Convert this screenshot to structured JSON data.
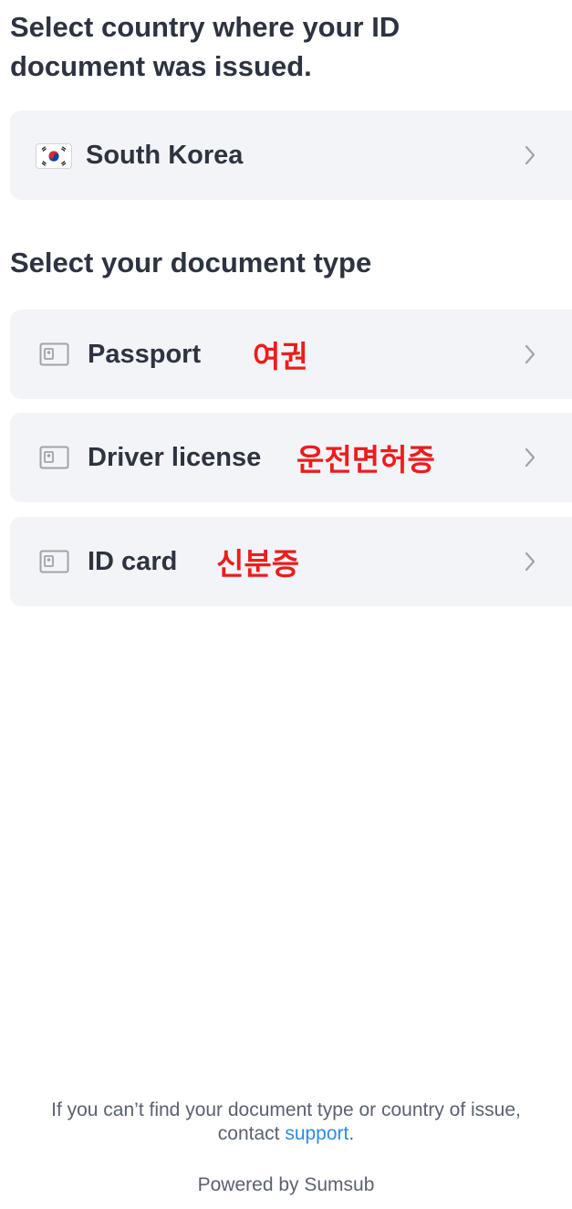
{
  "country_section": {
    "heading_line1": "Select country where your ID",
    "heading_line2": "document was issued.",
    "selected_country": "South Korea",
    "flag_icon": "south-korea-flag-icon"
  },
  "document_section": {
    "heading": "Select your document type",
    "options": [
      {
        "label": "Passport",
        "annotation": "여권",
        "icon": "id-card-icon"
      },
      {
        "label": "Driver license",
        "annotation": "운전면허증",
        "icon": "id-card-icon"
      },
      {
        "label": "ID card",
        "annotation": "신분증",
        "icon": "id-card-icon"
      }
    ]
  },
  "footer": {
    "note_line1": "If you can’t find your document type or country of issue,",
    "note_line2_prefix": "contact",
    "support_link": "support",
    "note_line2_suffix": ".",
    "powered_by": "Powered by Sumsub"
  },
  "colors": {
    "annotation": "#ee1c1c",
    "link": "#2e8ae6",
    "row_background": "#f3f4f7"
  }
}
